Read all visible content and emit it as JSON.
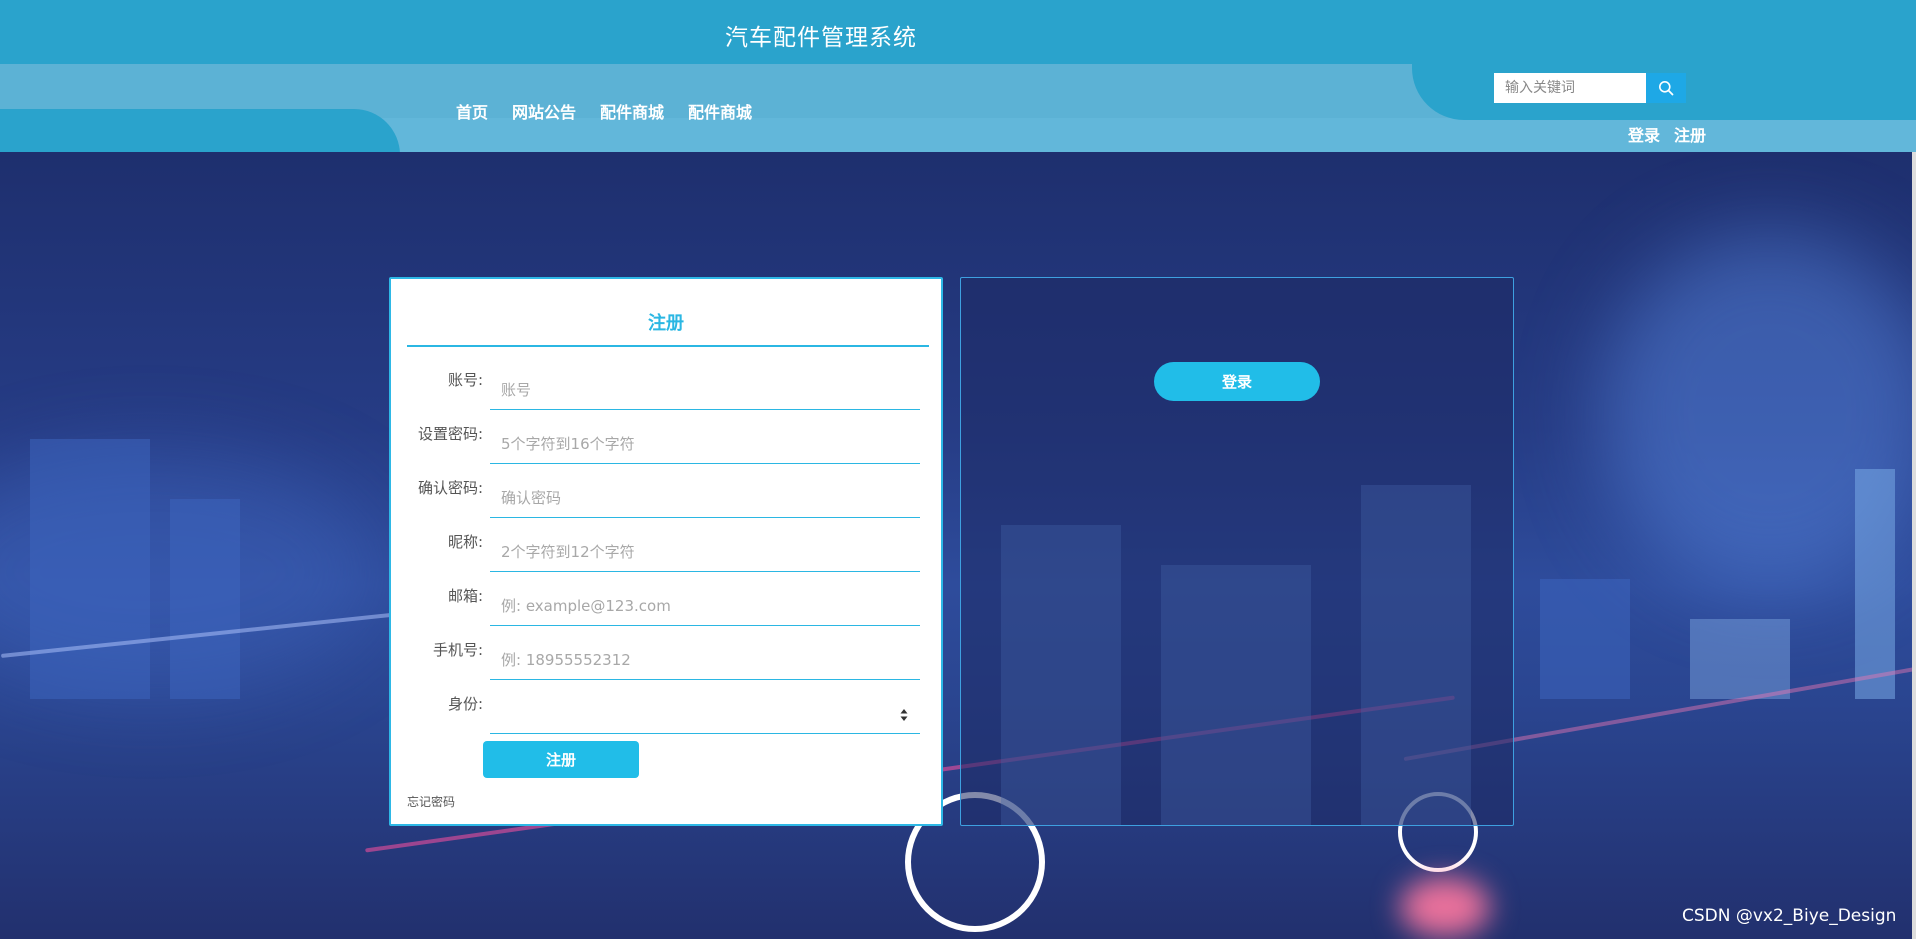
{
  "header": {
    "site_title": "汽车配件管理系统",
    "nav": [
      "首页",
      "网站公告",
      "配件商城",
      "配件商城"
    ],
    "search": {
      "placeholder": "输入关键词",
      "icon": "search-icon"
    },
    "auth": {
      "login": "登录",
      "register": "注册"
    }
  },
  "register": {
    "title": "注册",
    "fields": [
      {
        "label": "账号:",
        "placeholder": "账号"
      },
      {
        "label": "设置密码:",
        "placeholder": "5个字符到16个字符"
      },
      {
        "label": "确认密码:",
        "placeholder": "确认密码"
      },
      {
        "label": "昵称:",
        "placeholder": "2个字符到12个字符"
      },
      {
        "label": "邮箱:",
        "placeholder": "例: example@123.com"
      },
      {
        "label": "手机号:",
        "placeholder": "例: 18955552312"
      }
    ],
    "role": {
      "label": "身份:",
      "value": ""
    },
    "submit_label": "注册",
    "forgot_label": "忘记密码"
  },
  "login": {
    "button_label": "登录"
  },
  "watermark": "CSDN @vx2_Biye_Design",
  "colors": {
    "header": "#2aa3cc",
    "nav": "#5cb2d5",
    "accent": "#21bde8"
  }
}
